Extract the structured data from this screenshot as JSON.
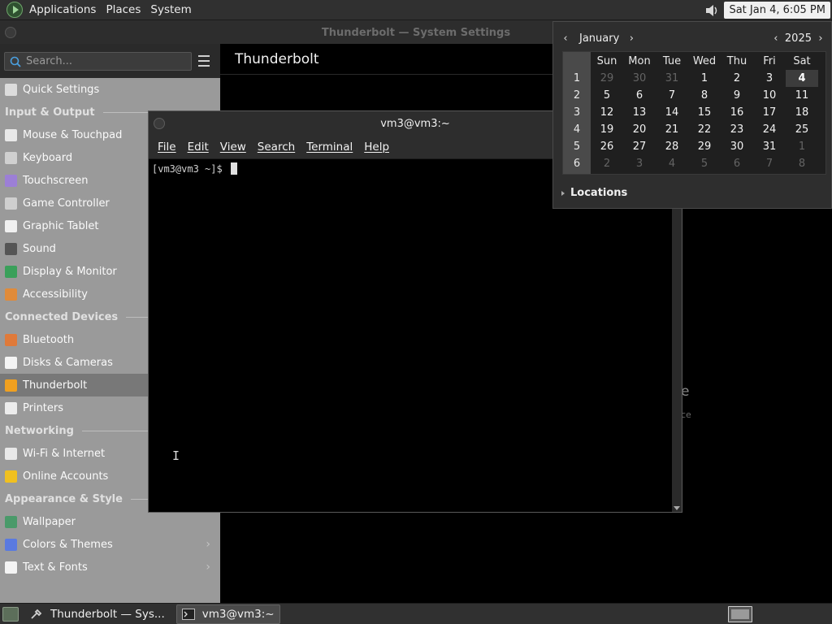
{
  "top_panel": {
    "menus": [
      "Applications",
      "Places",
      "System"
    ],
    "clock": "Sat Jan  4,  6:05 PM",
    "icons": {
      "app_logo": "app-logo-icon",
      "volume": "speaker-icon"
    }
  },
  "settings": {
    "window_title": "Thunderbolt — System Settings",
    "search_placeholder": "Search...",
    "content_title": "Thunderbolt",
    "peek_text": "e",
    "peek_subtext": "ce",
    "sidebar": [
      {
        "kind": "item",
        "label": "Quick Settings",
        "icon": "quick-settings-icon",
        "color": "#dcdcdc"
      },
      {
        "kind": "header",
        "label": "Input & Output"
      },
      {
        "kind": "item",
        "label": "Mouse & Touchpad",
        "icon": "mouse-icon",
        "color": "#e8e8e8"
      },
      {
        "kind": "item",
        "label": "Keyboard",
        "icon": "keyboard-icon",
        "color": "#d0d0d0"
      },
      {
        "kind": "item",
        "label": "Touchscreen",
        "icon": "touchscreen-icon",
        "color": "#9c7fd6"
      },
      {
        "kind": "item",
        "label": "Game Controller",
        "icon": "game-controller-icon",
        "color": "#cfcfcf"
      },
      {
        "kind": "item",
        "label": "Graphic Tablet",
        "icon": "graphic-tablet-icon",
        "color": "#f0f0f0"
      },
      {
        "kind": "item",
        "label": "Sound",
        "icon": "speaker-icon",
        "color": "#555555"
      },
      {
        "kind": "item",
        "label": "Display & Monitor",
        "icon": "monitor-icon",
        "color": "#3aa05a"
      },
      {
        "kind": "item",
        "label": "Accessibility",
        "icon": "accessibility-icon",
        "color": "#e08b3a"
      },
      {
        "kind": "header",
        "label": "Connected Devices"
      },
      {
        "kind": "item",
        "label": "Bluetooth",
        "icon": "bluetooth-icon",
        "color": "#e07a3a"
      },
      {
        "kind": "item",
        "label": "Disks & Cameras",
        "icon": "disk-icon",
        "color": "#f4f4f4"
      },
      {
        "kind": "item",
        "label": "Thunderbolt",
        "icon": "thunderbolt-icon",
        "color": "#f0a020",
        "active": true
      },
      {
        "kind": "item",
        "label": "Printers",
        "icon": "printer-icon",
        "color": "#ececec"
      },
      {
        "kind": "header",
        "label": "Networking"
      },
      {
        "kind": "item",
        "label": "Wi-Fi & Internet",
        "icon": "network-icon",
        "color": "#e8e8e8"
      },
      {
        "kind": "item",
        "label": "Online Accounts",
        "icon": "online-accounts-icon",
        "color": "#f0c020"
      },
      {
        "kind": "header",
        "label": "Appearance & Style"
      },
      {
        "kind": "item",
        "label": "Wallpaper",
        "icon": "wallpaper-icon",
        "color": "#4a9a6a"
      },
      {
        "kind": "item",
        "label": "Colors & Themes",
        "icon": "colors-themes-icon",
        "color": "#5a7ae0",
        "chevron": "›"
      },
      {
        "kind": "item",
        "label": "Text & Fonts",
        "icon": "text-fonts-icon",
        "color": "#f4f4f4",
        "chevron": "›"
      }
    ]
  },
  "terminal": {
    "title": "vm3@vm3:~",
    "menu": [
      "File",
      "Edit",
      "View",
      "Search",
      "Terminal",
      "Help"
    ],
    "prompt": "[vm3@vm3 ~]$ "
  },
  "calendar": {
    "month": "January",
    "year": "2025",
    "prev": "‹",
    "next": "›",
    "weekdays": [
      "Sun",
      "Mon",
      "Tue",
      "Wed",
      "Thu",
      "Fri",
      "Sat"
    ],
    "weeks": [
      {
        "num": "1",
        "days": [
          [
            "29",
            "oth"
          ],
          [
            "30",
            "oth"
          ],
          [
            "31",
            "oth"
          ],
          [
            "1",
            "cur"
          ],
          [
            "2",
            "cur"
          ],
          [
            "3",
            "cur"
          ],
          [
            "4",
            "today"
          ]
        ]
      },
      {
        "num": "2",
        "days": [
          [
            "5",
            "cur"
          ],
          [
            "6",
            "cur"
          ],
          [
            "7",
            "cur"
          ],
          [
            "8",
            "cur"
          ],
          [
            "9",
            "cur"
          ],
          [
            "10",
            "cur"
          ],
          [
            "11",
            "cur"
          ]
        ]
      },
      {
        "num": "3",
        "days": [
          [
            "12",
            "cur"
          ],
          [
            "13",
            "cur"
          ],
          [
            "14",
            "cur"
          ],
          [
            "15",
            "cur"
          ],
          [
            "16",
            "cur"
          ],
          [
            "17",
            "cur"
          ],
          [
            "18",
            "cur"
          ]
        ]
      },
      {
        "num": "4",
        "days": [
          [
            "19",
            "cur"
          ],
          [
            "20",
            "cur"
          ],
          [
            "21",
            "cur"
          ],
          [
            "22",
            "cur"
          ],
          [
            "23",
            "cur"
          ],
          [
            "24",
            "cur"
          ],
          [
            "25",
            "cur"
          ]
        ]
      },
      {
        "num": "5",
        "days": [
          [
            "26",
            "cur"
          ],
          [
            "27",
            "cur"
          ],
          [
            "28",
            "cur"
          ],
          [
            "29",
            "cur"
          ],
          [
            "30",
            "cur"
          ],
          [
            "31",
            "cur"
          ],
          [
            "1",
            "oth"
          ]
        ]
      },
      {
        "num": "6",
        "days": [
          [
            "2",
            "oth"
          ],
          [
            "3",
            "oth"
          ],
          [
            "4",
            "oth"
          ],
          [
            "5",
            "oth"
          ],
          [
            "6",
            "oth"
          ],
          [
            "7",
            "oth"
          ],
          [
            "8",
            "oth"
          ]
        ]
      }
    ],
    "locations_label": "Locations"
  },
  "taskbar": {
    "tasks": [
      {
        "label": "Thunderbolt — Sys...",
        "icon": "settings-tools-icon",
        "active": false
      },
      {
        "label": "vm3@vm3:~",
        "icon": "terminal-icon",
        "active": true
      }
    ]
  }
}
